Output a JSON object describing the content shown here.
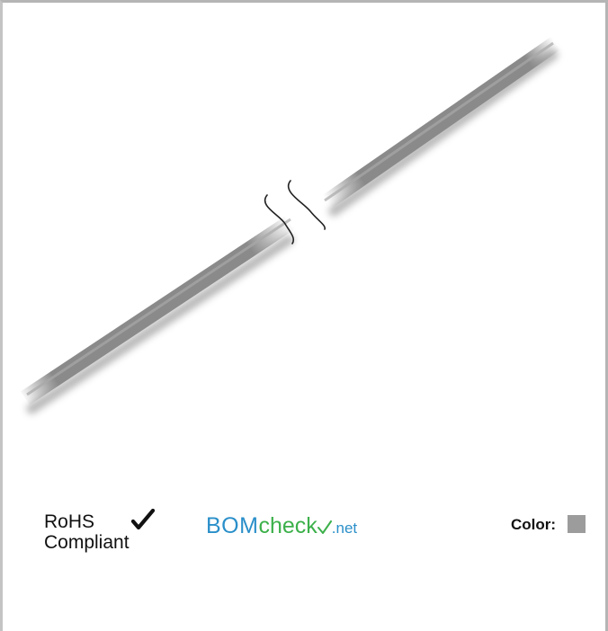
{
  "labels": {
    "rohs_line1": "RoHS",
    "rohs_line2": "Compliant",
    "bomcheck_bom": "BOM",
    "bomcheck_check": "check",
    "bomcheck_net": ".net",
    "color_label": "Color:"
  },
  "icons": {
    "rohs_check": "check-mark-icon",
    "bomcheck_check": "check-mark-icon",
    "break": "wavy-break-icon"
  },
  "colors": {
    "cable": "#8a8a8a",
    "swatch": "#9c9c9c",
    "bomcheck_blue": "#2a8fc9",
    "bomcheck_green": "#3cb04a",
    "border": "#b5b5b5"
  }
}
